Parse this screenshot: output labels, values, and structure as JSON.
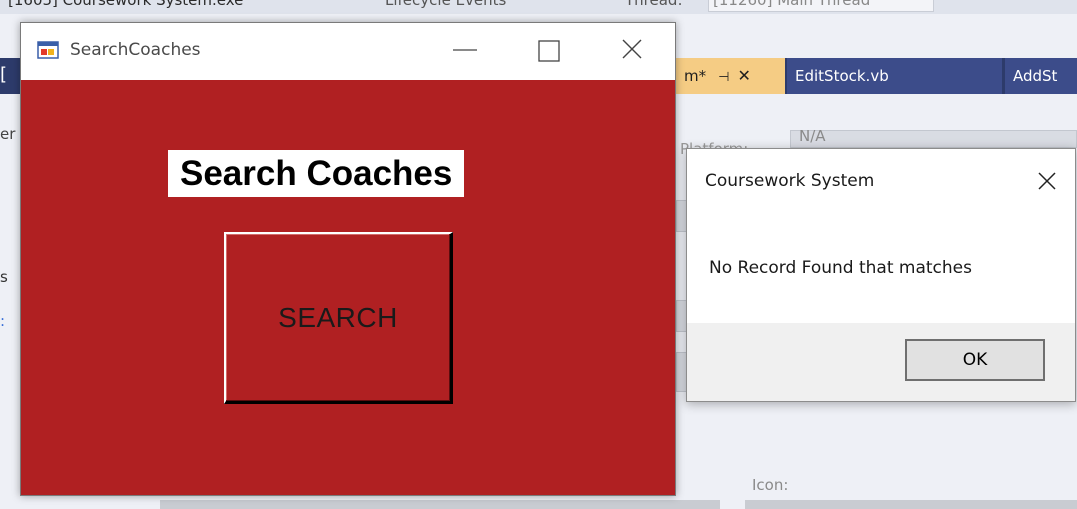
{
  "ide": {
    "top_text_1": "[1605] Coursework System.exe",
    "top_text_2": "Lifecycle Events",
    "top_text_3": "Thread:",
    "top_text_4": "[11260] Main Thread",
    "tabs": [
      {
        "label": "m*"
      },
      {
        "label": "EditStock.vb"
      },
      {
        "label": "AddSt"
      }
    ],
    "left_fragments": [
      "[",
      "er",
      "s",
      ":"
    ],
    "platform_label": "Platform:",
    "platform_value": "N/A",
    "icon_label": "Icon:"
  },
  "form": {
    "title": "SearchCoaches",
    "heading": "Search Coaches",
    "search_button_label": "SEARCH",
    "background_color": "#b02022"
  },
  "message_box": {
    "title": "Coursework System",
    "message": "No Record Found that matches",
    "ok_label": "OK"
  }
}
